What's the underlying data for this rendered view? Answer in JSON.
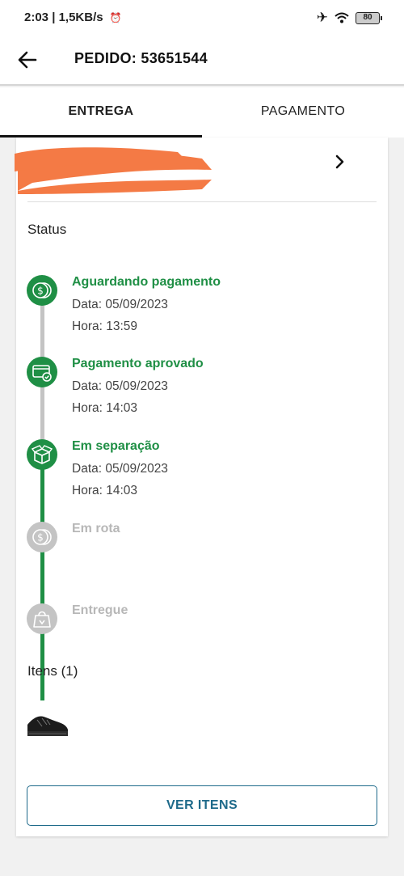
{
  "status_bar": {
    "time": "2:03",
    "network_speed": "1,5KB/s",
    "battery": "80"
  },
  "header": {
    "title": "PEDIDO: 53651544"
  },
  "tabs": [
    {
      "label": "ENTREGA",
      "active": true
    },
    {
      "label": "PAGAMENTO",
      "active": false
    }
  ],
  "status_section": {
    "title": "Status",
    "steps": [
      {
        "label": "Aguardando pagamento",
        "date": "Data: 05/09/2023",
        "time": "Hora: 13:59",
        "state": "done",
        "icon": "dollar-coins-icon"
      },
      {
        "label": "Pagamento aprovado",
        "date": "Data: 05/09/2023",
        "time": "Hora: 14:03",
        "state": "done",
        "icon": "card-check-icon"
      },
      {
        "label": "Em separação",
        "date": "Data: 05/09/2023",
        "time": "Hora: 14:03",
        "state": "done",
        "icon": "box-icon"
      },
      {
        "label": "Em rota",
        "state": "pending",
        "icon": "dollar-coins-icon"
      },
      {
        "label": "Entregue",
        "state": "pending",
        "icon": "shopping-bag-icon"
      }
    ]
  },
  "items_section": {
    "title": "Itens (1)",
    "button_label": "VER ITENS"
  },
  "colors": {
    "green": "#1f8f45",
    "gray": "#c4c4c4",
    "button_blue": "#1e6a8a",
    "redaction": "#f47a45"
  }
}
